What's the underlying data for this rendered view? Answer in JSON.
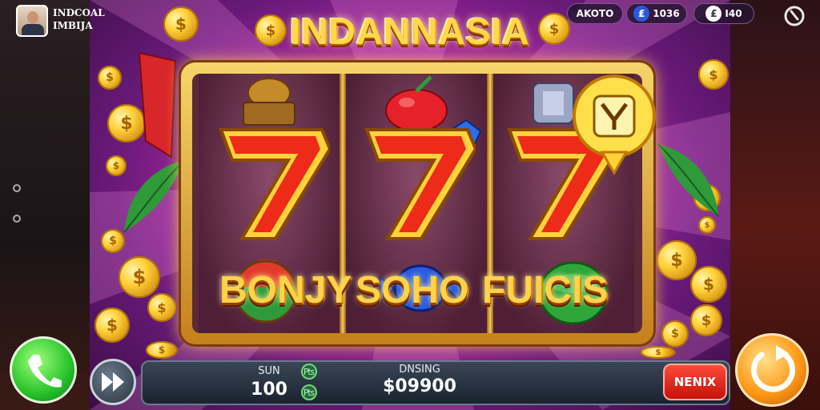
{
  "player": {
    "name_line1": "INDCOAL",
    "name_line2": "IMBIJA"
  },
  "hud": {
    "badge_label": "AKOTO",
    "coin_value": "1036",
    "gem_value": "I40"
  },
  "title": "INDANNASIA",
  "reels": [
    {
      "top_symbol": "golden-bell-icon",
      "main_symbol": "red-seven-icon",
      "bottom_symbol": "rainbow-ball-icon"
    },
    {
      "top_symbol": "red-apple-icon",
      "main_symbol": "red-seven-icon",
      "bottom_symbol": "blue-candy-icon"
    },
    {
      "top_symbol": "silver-trophy-icon",
      "main_symbol": "red-seven-icon",
      "bottom_symbol": "green-gem-icon"
    }
  ],
  "bonus_words": [
    "BONJY",
    "SOHO",
    "FUICIS"
  ],
  "bottom_bar": {
    "bet_label": "SUN",
    "bet_value": "100",
    "win_label": "DNSING",
    "win_value": "$09900",
    "menu_label": "NENIX"
  },
  "colors": {
    "accent_gold": "#ffd34a",
    "background_magenta": "#c62fb0",
    "menu_red": "#e0231a",
    "call_green": "#27c22a",
    "spin_orange": "#ff9a1a"
  }
}
